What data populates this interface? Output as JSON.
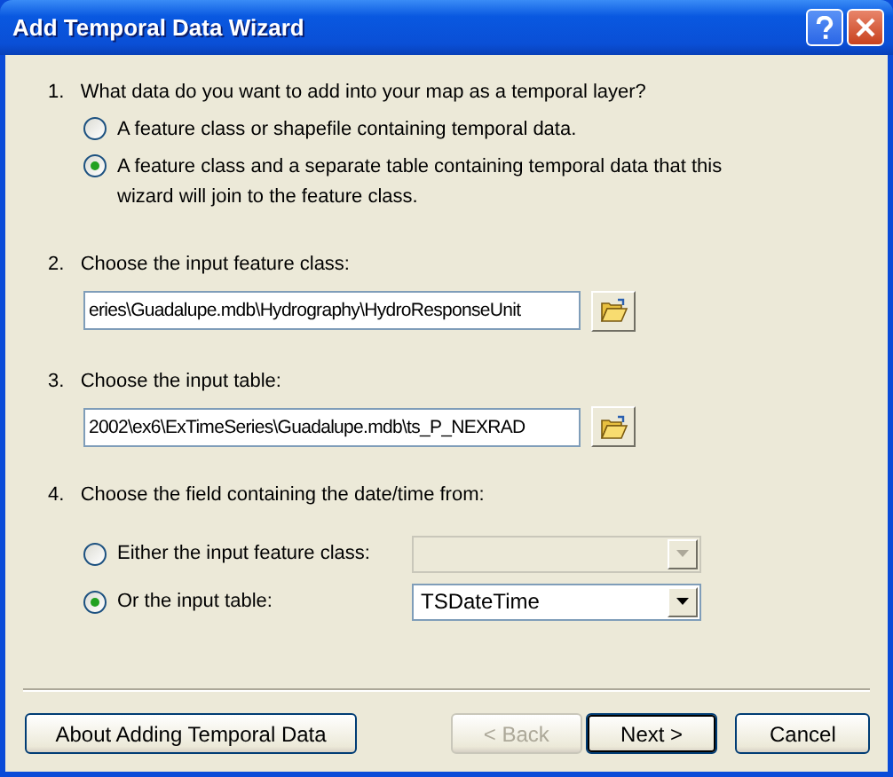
{
  "window": {
    "title": "Add Temporal Data Wizard"
  },
  "steps": [
    {
      "kind": "radio-choice",
      "number": "1.",
      "label": "What data do you want to add into your map as a temporal layer?",
      "options": [
        {
          "label": "A feature class or shapefile containing temporal data.",
          "selected": false
        },
        {
          "label": "A feature class and a separate table containing temporal data that this wizard will join to the feature class.",
          "selected": true
        }
      ]
    },
    {
      "kind": "path",
      "number": "2.",
      "label": "Choose the input feature class:",
      "value": "eries\\Guadalupe.mdb\\Hydrography\\HydroResponseUnit"
    },
    {
      "kind": "path",
      "number": "3.",
      "label": "Choose the input table:",
      "value": "2002\\ex6\\ExTimeSeries\\Guadalupe.mdb\\ts_P_NEXRAD"
    },
    {
      "kind": "field-choice",
      "number": "4.",
      "label": "Choose the field containing the date/time from:",
      "options": [
        {
          "label": "Either the input feature class:",
          "selected": false,
          "disabled": true
        },
        {
          "label": "Or the input table:",
          "selected": true,
          "disabled": false,
          "value": "TSDateTime"
        }
      ]
    }
  ],
  "buttons": [
    {
      "label": "About Adding Temporal Data",
      "disabled": false,
      "default": false
    },
    {
      "label": "< Back",
      "disabled": true,
      "default": false
    },
    {
      "label": "Next >",
      "disabled": false,
      "default": true
    },
    {
      "label": "Cancel",
      "disabled": false,
      "default": false
    }
  ]
}
